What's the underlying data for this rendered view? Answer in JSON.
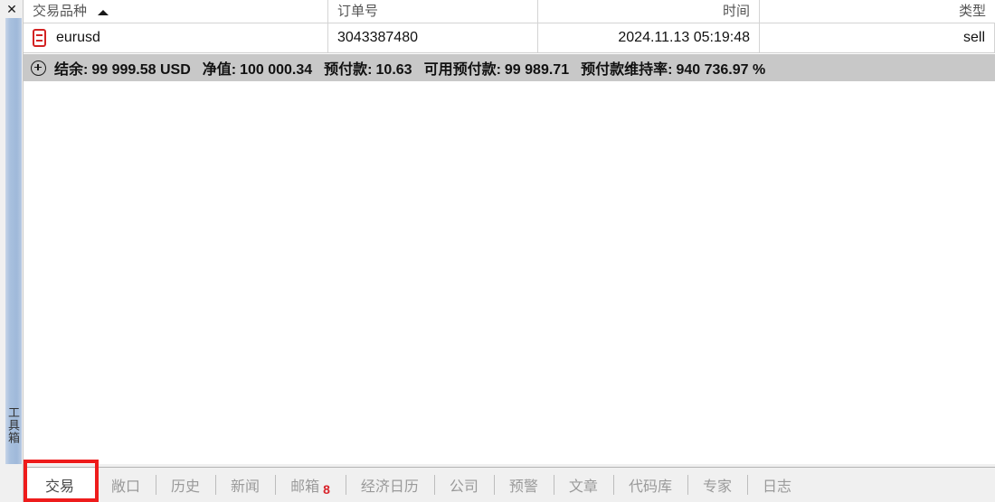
{
  "panel": {
    "close_icon": "close-icon",
    "rail_label": "工具箱"
  },
  "table": {
    "columns": [
      {
        "label": "交易品种",
        "align": "left",
        "sort": "asc"
      },
      {
        "label": "订单号",
        "align": "left",
        "sort": "none"
      },
      {
        "label": "时间",
        "align": "right",
        "sort": "none"
      },
      {
        "label": "类型",
        "align": "right",
        "sort": "none"
      }
    ],
    "rows": [
      {
        "icon": "sell-position-icon",
        "symbol": "eurusd",
        "order": "3043387480",
        "time": "2024.11.13 05:19:48",
        "type": "sell"
      }
    ]
  },
  "summary": {
    "icon": "plus-circle-icon",
    "items": [
      {
        "label": "结余:",
        "value": "99 999.58 USD"
      },
      {
        "label": "净值:",
        "value": "100 000.34"
      },
      {
        "label": "预付款:",
        "value": "10.63"
      },
      {
        "label": "可用预付款:",
        "value": "99 989.71"
      },
      {
        "label": "预付款维持率:",
        "value": "940 736.97 %"
      }
    ]
  },
  "tabs": [
    {
      "label": "交易",
      "active": true,
      "badge": ""
    },
    {
      "label": "敞口",
      "active": false,
      "badge": ""
    },
    {
      "label": "历史",
      "active": false,
      "badge": ""
    },
    {
      "label": "新闻",
      "active": false,
      "badge": ""
    },
    {
      "label": "邮箱",
      "active": false,
      "badge": "8"
    },
    {
      "label": "经济日历",
      "active": false,
      "badge": ""
    },
    {
      "label": "公司",
      "active": false,
      "badge": ""
    },
    {
      "label": "预警",
      "active": false,
      "badge": ""
    },
    {
      "label": "文章",
      "active": false,
      "badge": ""
    },
    {
      "label": "代码库",
      "active": false,
      "badge": ""
    },
    {
      "label": "专家",
      "active": false,
      "badge": ""
    },
    {
      "label": "日志",
      "active": false,
      "badge": ""
    }
  ],
  "annotation": {
    "color": "#ee1c1c",
    "target": "交易"
  }
}
